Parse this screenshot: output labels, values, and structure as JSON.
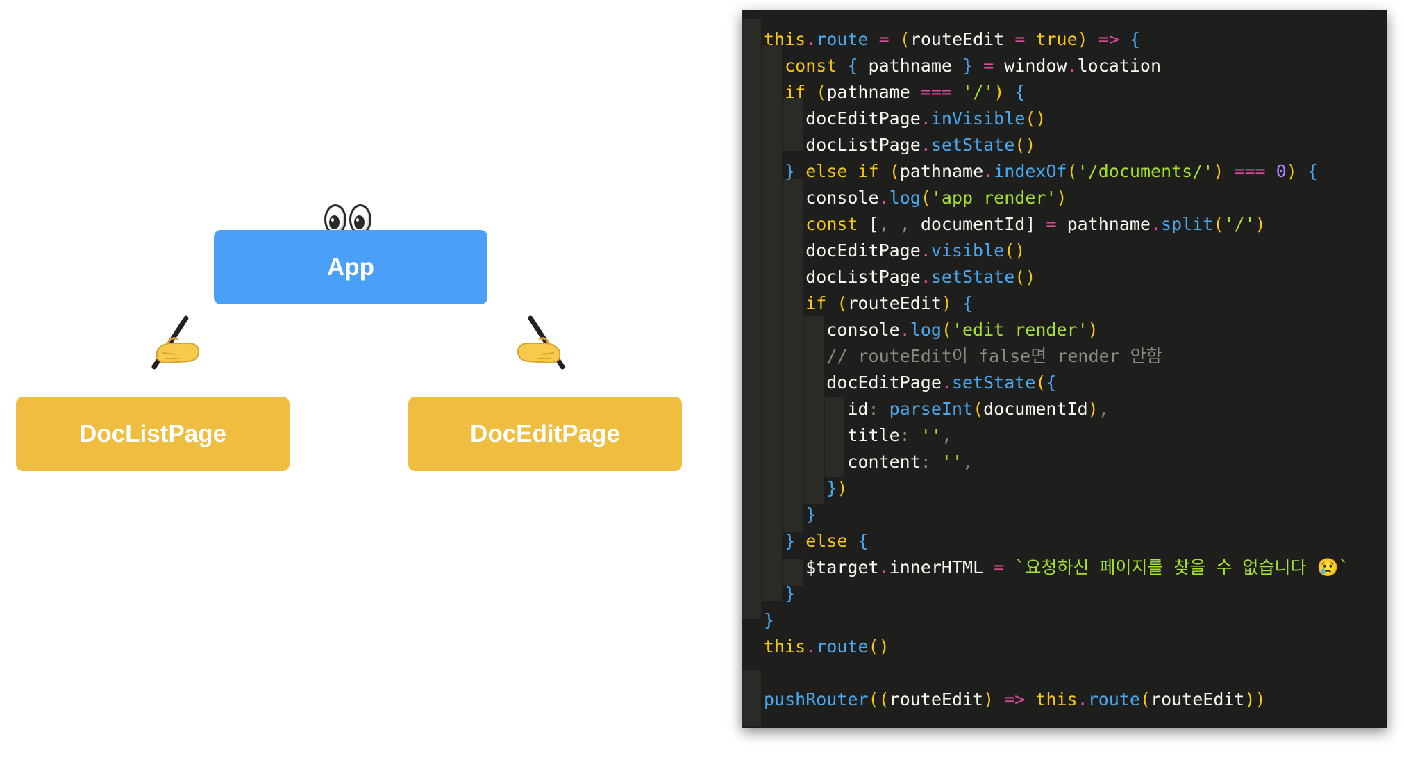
{
  "diagram": {
    "nodes": {
      "app": "App",
      "doc_list_page": "DocListPage",
      "doc_edit_page": "DocEditPage"
    },
    "icons": [
      "eyes-icon",
      "writing-hand-icon"
    ],
    "colors": {
      "app_node": "#4aa0f8",
      "page_node": "#efbd3f",
      "node_text": "#ffffff"
    }
  },
  "code": {
    "background": "#1e1f1c",
    "colors": {
      "keyword": "#f5c518",
      "function": "#4aa8f0",
      "operator": "#e04ba0",
      "string": "#a6e22e",
      "comment": "#8a8a80",
      "plain": "#f8f8f2"
    },
    "lines": [
      "this.route = (routeEdit = true) => {",
      "  const { pathname } = window.location",
      "  if (pathname === '/') {",
      "    docEditPage.inVisible()",
      "    docListPage.setState()",
      "  } else if (pathname.indexOf('/documents/') === 0) {",
      "    console.log('app render')",
      "    const [, , documentId] = pathname.split('/')",
      "    docEditPage.visible()",
      "    docListPage.setState()",
      "    if (routeEdit) {",
      "      console.log('edit render')",
      "      // routeEdit이 false면 render 안함",
      "      docEditPage.setState({",
      "        id: parseInt(documentId),",
      "        title: '',",
      "        content: '',",
      "      })",
      "    }",
      "  } else {",
      "    $target.innerHTML = `요청하신 페이지를 찾을 수 없습니다 😢`",
      "  }",
      "}",
      "this.route()",
      "",
      "pushRouter((routeEdit) => this.route(routeEdit))"
    ]
  }
}
